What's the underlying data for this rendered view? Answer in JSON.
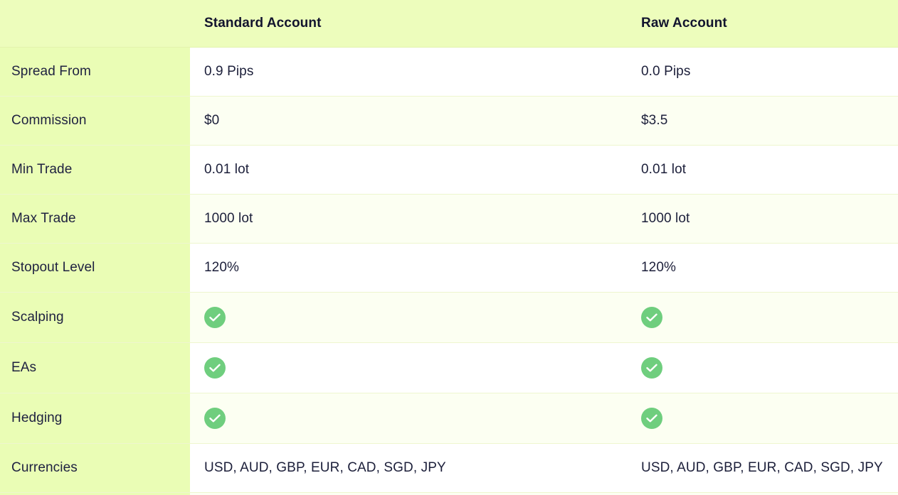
{
  "header": {
    "corner": "",
    "standard_label": "Standard Account",
    "raw_label": "Raw Account"
  },
  "rows": [
    {
      "label": "Spread From",
      "standard": "0.9 Pips",
      "raw": "0.0 Pips"
    },
    {
      "label": "Commission",
      "standard": "$0",
      "raw": "$3.5"
    },
    {
      "label": "Min Trade",
      "standard": "0.01 lot",
      "raw": "0.01 lot"
    },
    {
      "label": "Max Trade",
      "standard": "1000 lot",
      "raw": "1000 lot"
    },
    {
      "label": "Stopout Level",
      "standard": "120%",
      "raw": "120%"
    },
    {
      "label": "Scalping",
      "standard_icon": "check-icon",
      "raw_icon": "check-icon"
    },
    {
      "label": "EAs",
      "standard_icon": "check-icon",
      "raw_icon": "check-icon"
    },
    {
      "label": "Hedging",
      "standard_icon": "check-icon",
      "raw_icon": "check-icon"
    },
    {
      "label": "Currencies",
      "standard": "USD, AUD, GBP, EUR, CAD, SGD, JPY",
      "raw": "USD, AUD, GBP, EUR, CAD, SGD, JPY"
    }
  ],
  "colors": {
    "header_bg": "#edfdbc",
    "label_col_bg": "#eafdb5",
    "alt_row_bg": "#fcfff2",
    "check_green": "#6fce7e",
    "text": "#1c1f3a"
  }
}
